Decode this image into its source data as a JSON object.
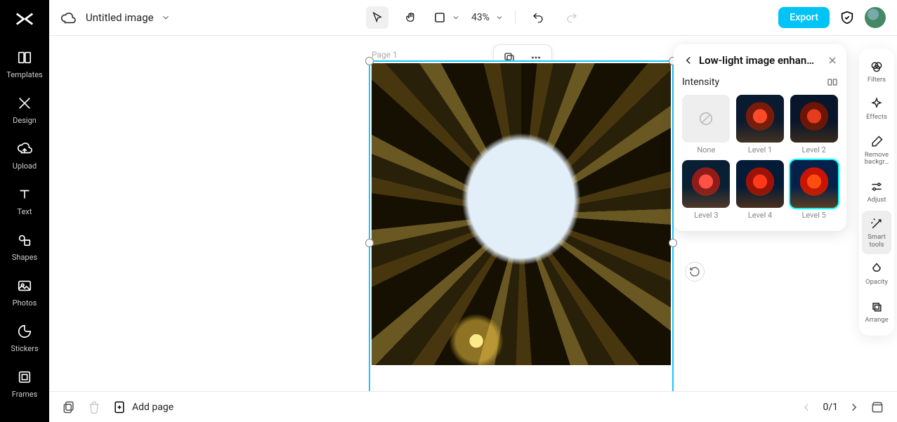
{
  "header": {
    "title": "Untitled image",
    "zoom": "43%",
    "export_label": "Export"
  },
  "left_sidebar": {
    "items": [
      {
        "label": "Templates",
        "icon": "templates-icon"
      },
      {
        "label": "Design",
        "icon": "design-icon"
      },
      {
        "label": "Upload",
        "icon": "upload-icon"
      },
      {
        "label": "Text",
        "icon": "text-icon"
      },
      {
        "label": "Shapes",
        "icon": "shapes-icon"
      },
      {
        "label": "Photos",
        "icon": "photos-icon"
      },
      {
        "label": "Stickers",
        "icon": "stickers-icon"
      },
      {
        "label": "Frames",
        "icon": "frames-icon"
      }
    ]
  },
  "canvas": {
    "page_label": "Page 1"
  },
  "panel": {
    "title": "Low-light image enhan…",
    "section_label": "Intensity",
    "options": [
      {
        "label": "None"
      },
      {
        "label": "Level 1"
      },
      {
        "label": "Level 2"
      },
      {
        "label": "Level 3"
      },
      {
        "label": "Level 4"
      },
      {
        "label": "Level 5"
      }
    ]
  },
  "right_sidebar": {
    "items": [
      {
        "label": "Filters"
      },
      {
        "label": "Effects"
      },
      {
        "label": "Remove backgr…"
      },
      {
        "label": "Adjust"
      },
      {
        "label": "Smart tools"
      },
      {
        "label": "Opacity"
      },
      {
        "label": "Arrange"
      }
    ],
    "active_index": 4
  },
  "bottom": {
    "add_page_label": "Add page",
    "page_counter": "0/1"
  }
}
